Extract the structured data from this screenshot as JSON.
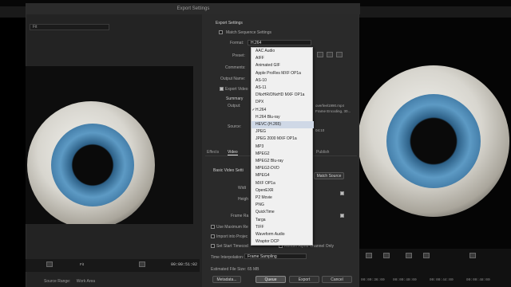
{
  "window": {
    "title": "Export Settings"
  },
  "left": {
    "source_dropdown": "Fit",
    "timecode": "00:00:51:02",
    "fit_dropdown": "Fit",
    "source_range_label": "Source Range:",
    "source_range_value": "Work Area"
  },
  "export_settings": {
    "section_title": "Export Settings",
    "match_sequence": "Match Sequence Settings",
    "format_label": "Format:",
    "format_value": "H.264",
    "preset_label": "Preset:",
    "comments_label": "Comments:",
    "output_name_label": "Output Name:",
    "export_video": "Export Video",
    "summary_label": "Summary",
    "output_label": "Output:",
    "source_label": "Source:",
    "output_path_fragment": "overfeel1990.mp4",
    "output_detail": "Frame Encoding, 30...",
    "source_detail": "04:10"
  },
  "format_menu": {
    "items": [
      {
        "label": "AAC Audio"
      },
      {
        "label": "AIFF"
      },
      {
        "label": "Animated GIF"
      },
      {
        "label": "Apple ProRes MXF OP1a"
      },
      {
        "label": "AS-10"
      },
      {
        "label": "AS-11"
      },
      {
        "label": "DNxHR/DNxHD MXF OP1a"
      },
      {
        "label": "DPX"
      },
      {
        "label": "H.264",
        "checked": true
      },
      {
        "label": "H.264 Blu-ray"
      },
      {
        "label": "HEVC (H.265)",
        "hover": true
      },
      {
        "label": "JPEG"
      },
      {
        "label": "JPEG 2000 MXF OP1a"
      },
      {
        "label": "MP3"
      },
      {
        "label": "MPEG2"
      },
      {
        "label": "MPEG2 Blu-ray"
      },
      {
        "label": "MPEG2-DVD"
      },
      {
        "label": "MPEG4"
      },
      {
        "label": "MXF OP1a"
      },
      {
        "label": "OpenEXR"
      },
      {
        "label": "P2 Movie"
      },
      {
        "label": "PNG"
      },
      {
        "label": "QuickTime"
      },
      {
        "label": "Targa"
      },
      {
        "label": "TIFF"
      },
      {
        "label": "Waveform Audio"
      },
      {
        "label": "Wraptor DCP"
      }
    ]
  },
  "tabs": [
    {
      "label": "Effects"
    },
    {
      "label": "Video",
      "active": true
    },
    {
      "label": "Publish"
    }
  ],
  "video": {
    "basic_label": "Basic Video Setti",
    "width_label": "Widt",
    "height_label": "Heigh",
    "frame_rate_label": "Frame Ra",
    "match_source_button": "Match Source"
  },
  "bottom": {
    "use_max": "Use Maximum Re",
    "import_project": "Import into Projec",
    "set_start_timecode": "Set Start Timecod",
    "render_alpha": "Render Alpha Channel Only",
    "time_interp_label": "Time Interpolation:",
    "time_interp_value": "Frame Sampling",
    "est_file_size_label": "Estimated File Size:",
    "est_file_size_value": "65 MB",
    "metadata": "Metadata...",
    "queue": "Queue",
    "export": "Export",
    "cancel": "Cancel"
  },
  "right_timeline": {
    "times": [
      "00:00:36:00",
      "00:00:40:00",
      "00:00:44:00",
      "00:00:48:00"
    ]
  },
  "colors": {
    "iris_blue": "#4f8ec0",
    "menu_bg": "#f0f0f0",
    "menu_hover": "#cfd8e6"
  }
}
